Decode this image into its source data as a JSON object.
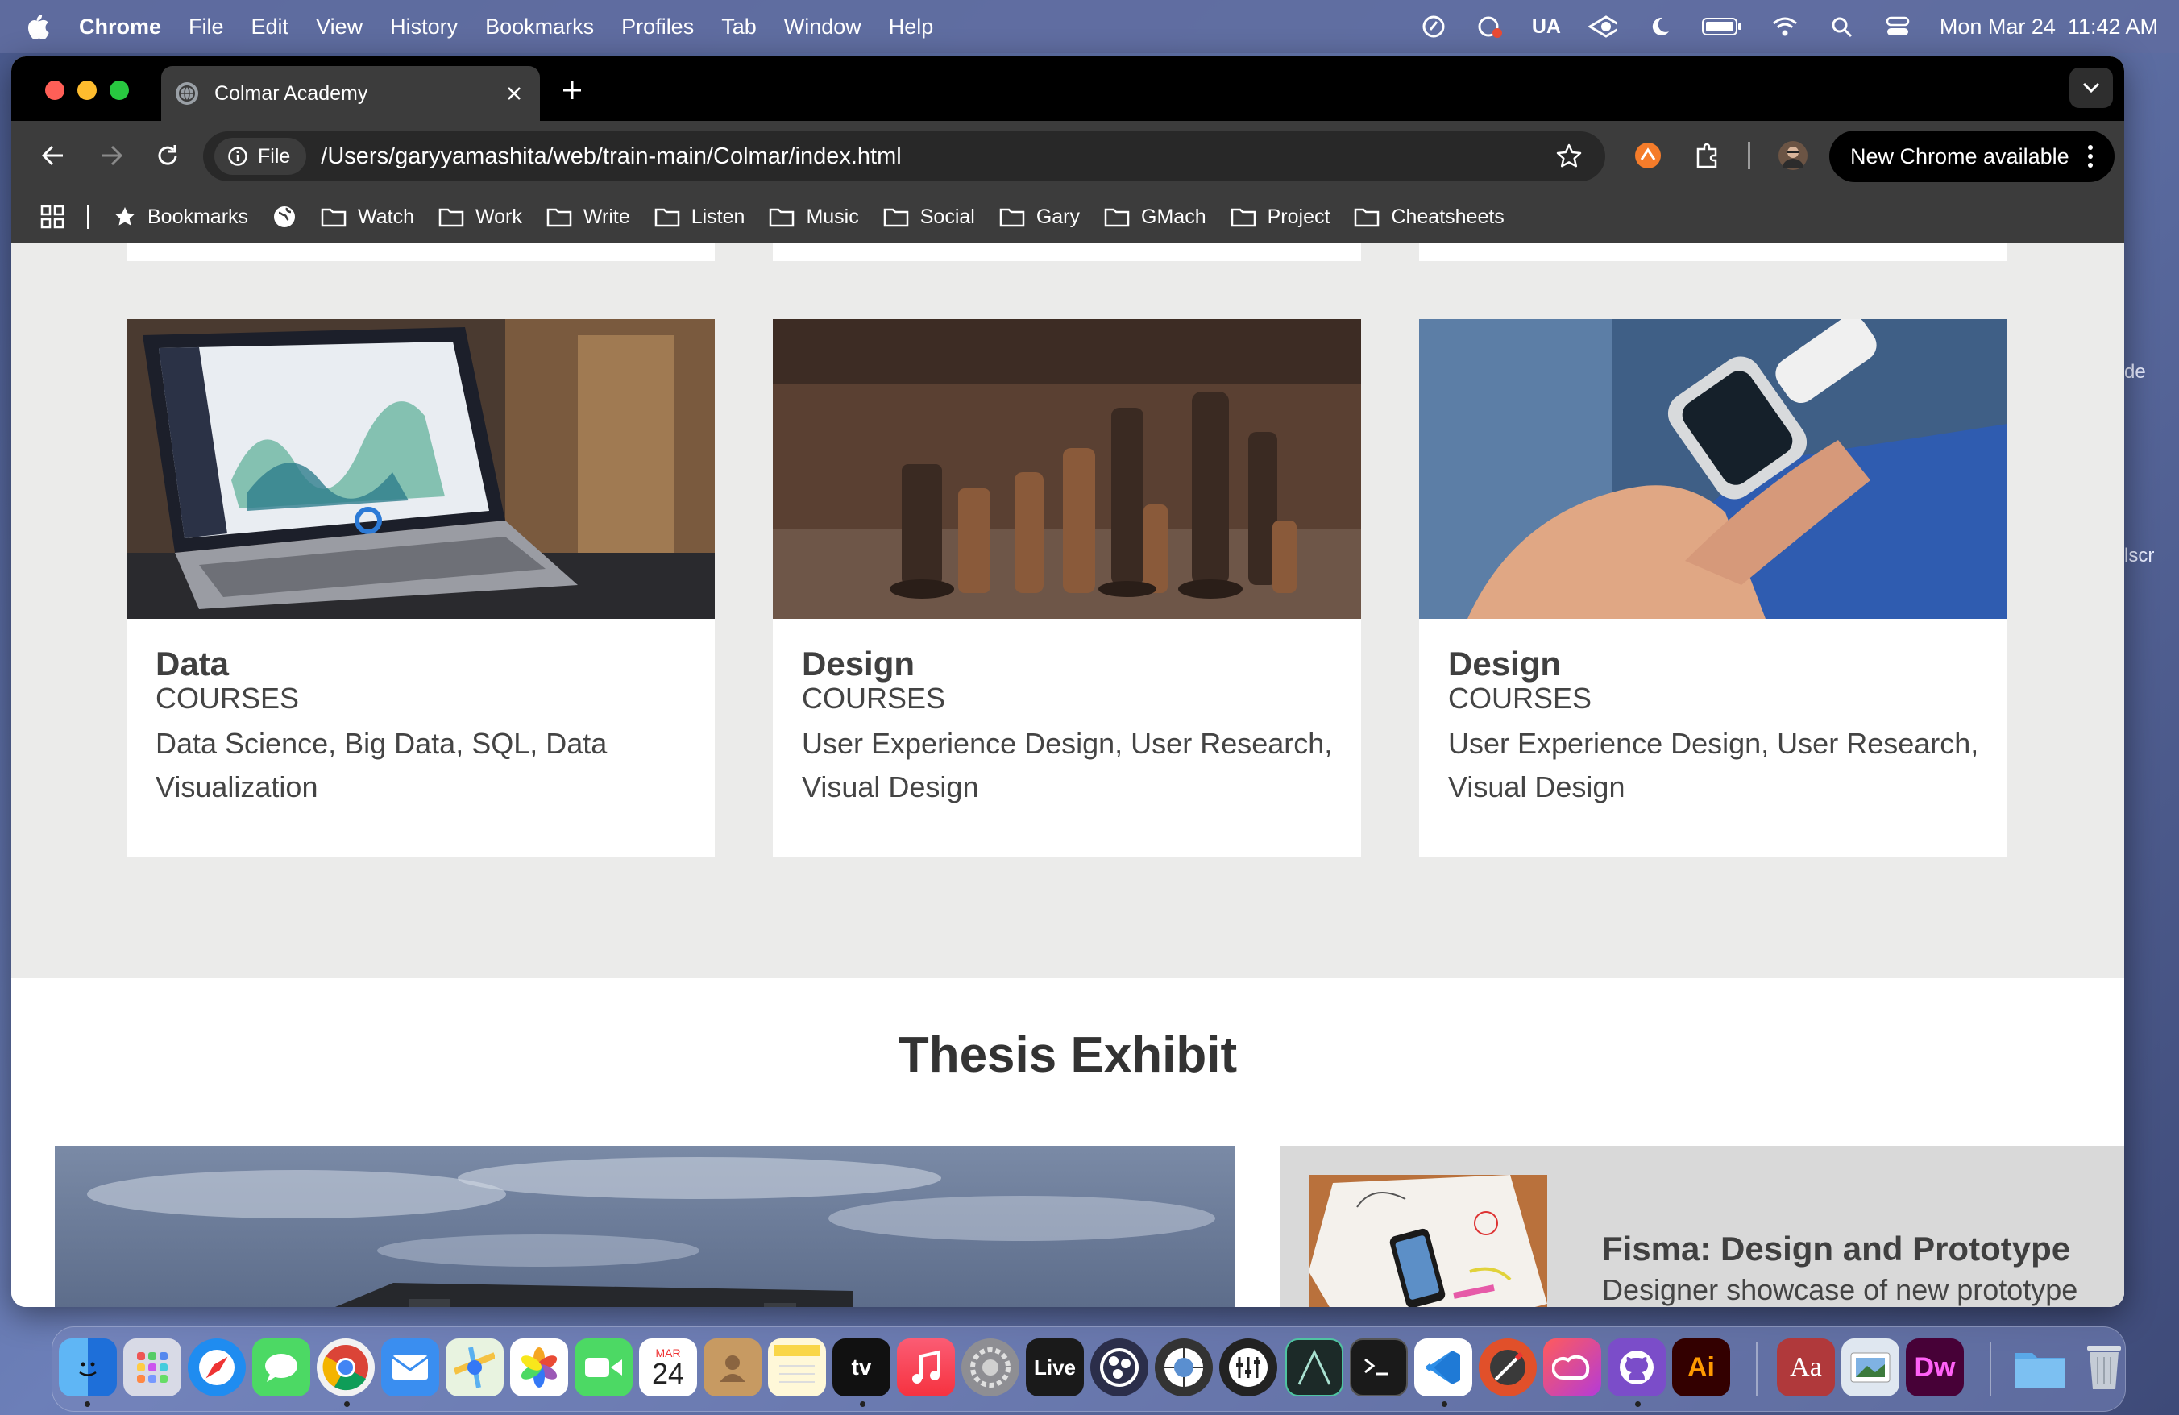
{
  "menubar": {
    "app": "Chrome",
    "items": [
      "File",
      "Edit",
      "View",
      "History",
      "Bookmarks",
      "Profiles",
      "Tab",
      "Window",
      "Help"
    ],
    "input_indicator": "UA",
    "datetime": "Mon Mar 24  11:42 AM"
  },
  "desktop": {
    "frag1": "de",
    "frag2": "lscr"
  },
  "tab": {
    "title": "Colmar Academy"
  },
  "omnibox": {
    "chip": "File",
    "url": "/Users/garyyamashita/web/train-main/Colmar/index.html"
  },
  "update": {
    "label": "New Chrome available"
  },
  "bookmarks": {
    "main": "Bookmarks",
    "folders": [
      "Watch",
      "Work",
      "Write",
      "Listen",
      "Music",
      "Social",
      "Gary",
      "GMach",
      "Project",
      "Cheatsheets"
    ]
  },
  "cards": [
    {
      "title": "Data",
      "sub": "COURSES",
      "desc": "Data Science, Big Data, SQL, Data Visualization"
    },
    {
      "title": "Design",
      "sub": "COURSES",
      "desc": "User Experience Design, User Research, Visual Design"
    },
    {
      "title": "Design",
      "sub": "COURSES",
      "desc": "User Experience Design, User Research, Visual Design"
    }
  ],
  "thesis": {
    "heading": "Thesis Exhibit",
    "side_title": "Fisma: Design and Prototype",
    "side_desc": "Designer showcase of new prototype product"
  },
  "dock": {
    "calendar_month": "MAR",
    "calendar_day": "24",
    "tv": "tv",
    "live": "Live",
    "ai": "Ai",
    "dict": "Aa",
    "dw": "Dw"
  },
  "colors": {
    "menubar": "#606ca0",
    "tabbar": "#000000",
    "toolbar": "#3c3c3c",
    "page_bg": "#ebebea",
    "text": "#404040"
  }
}
